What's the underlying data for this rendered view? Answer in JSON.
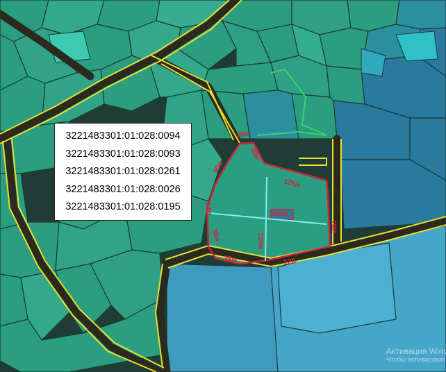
{
  "parcels": {
    "numbers": [
      "3221483301:01:028:0094",
      "3221483301:01:028:0093",
      "3221483301:01:028:0261",
      "3221483301:01:028:0026",
      "3221483301:01:028:0195"
    ]
  },
  "measurements": {
    "top": "20м",
    "upper_right": "49м",
    "left_upper": "90м",
    "right_diag": "125м",
    "left": "64м",
    "center_v": "120м",
    "center_h": "168м",
    "right": "70м",
    "left_lower": "38м",
    "bottom_left": "35м",
    "bottom": "120"
  },
  "watermark": {
    "line1": "Активация Wind",
    "line2": "Чтобы активироват"
  },
  "colors": {
    "parcel_fill": "#2a9e7f",
    "parcel_fill_light": "#35b89a",
    "parcel_blue": "#2a7aa0",
    "sea_blue": "#45a6c9",
    "parcel_border": "#1e3d36",
    "road": "#2b2a1f",
    "road_outline": "#e6e030",
    "plot_outline": "#cf2338",
    "green_outline": "#39d46a",
    "cross_line": "#7ff0ee"
  }
}
